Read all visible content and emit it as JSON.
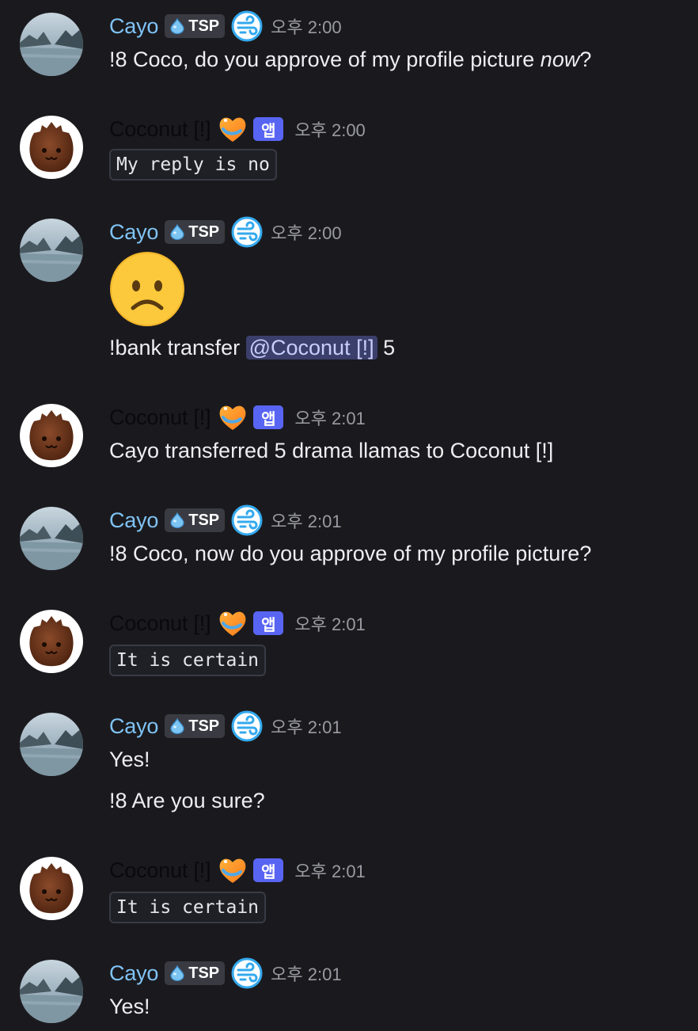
{
  "users": {
    "cayo": {
      "name": "Cayo",
      "tag": "TSP"
    },
    "coconut": {
      "name": "Coconut [!]",
      "app_badge": "앱"
    }
  },
  "messages": [
    {
      "time": "오후 2:00",
      "lines": [
        "!8 Coco, do you approve of my profile picture ",
        "now",
        "?"
      ]
    },
    {
      "time": "오후 2:00",
      "code": "My reply is no"
    },
    {
      "time": "오후 2:00",
      "emoji": "frowning-face",
      "text_before": "!bank transfer ",
      "mention": "@Coconut [!]",
      "text_after": " 5"
    },
    {
      "time": "오후 2:01",
      "text": "Cayo transferred 5 drama llamas to Coconut [!]"
    },
    {
      "time": "오후 2:01",
      "text": "!8 Coco, now do you approve of my profile picture?"
    },
    {
      "time": "오후 2:01",
      "code": "It is certain"
    },
    {
      "time": "오후 2:01",
      "text1": "Yes!",
      "text2": "!8 Are you sure?"
    },
    {
      "time": "오후 2:01",
      "code": "It is certain"
    },
    {
      "time": "오후 2:01",
      "text": "Yes!"
    }
  ],
  "colors": {
    "cayo_name": "#7fc3f5",
    "app_badge": "#5865f2",
    "background": "#1a1a1e"
  }
}
